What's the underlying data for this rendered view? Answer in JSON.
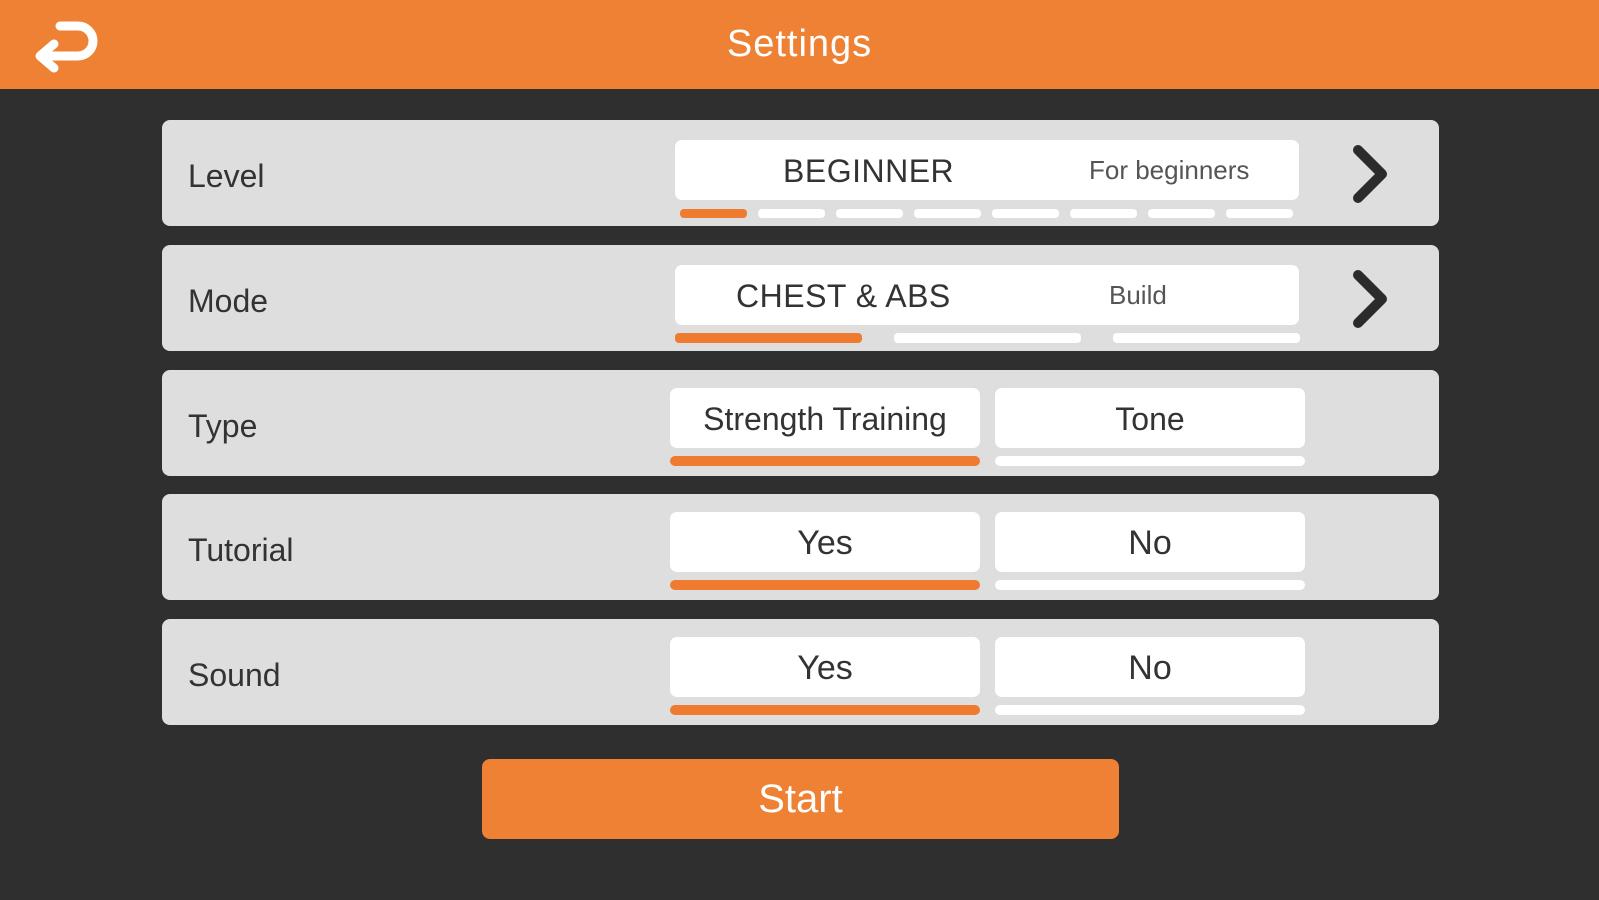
{
  "header": {
    "title": "Settings",
    "back_icon": "back-arrow-icon",
    "color": "#ee8133"
  },
  "level": {
    "label": "Level",
    "value": "BEGINNER",
    "description": "For beginners",
    "selected_index": 0,
    "total_levels": 8,
    "next_icon": "chevron-right-icon"
  },
  "mode": {
    "label": "Mode",
    "value": "CHEST & ABS",
    "description": "Build",
    "selected_index": 0,
    "total_modes": 3,
    "next_icon": "chevron-right-icon"
  },
  "type": {
    "label": "Type",
    "options": [
      "Strength Training",
      "Tone"
    ],
    "selected": "Strength Training"
  },
  "tutorial": {
    "label": "Tutorial",
    "options": [
      "Yes",
      "No"
    ],
    "selected": "Yes"
  },
  "sound": {
    "label": "Sound",
    "options": [
      "Yes",
      "No"
    ],
    "selected": "Yes"
  },
  "start_button": {
    "label": "Start"
  },
  "colors": {
    "accent": "#ee8133",
    "background": "#2f2f2f",
    "panel": "#dedede"
  }
}
